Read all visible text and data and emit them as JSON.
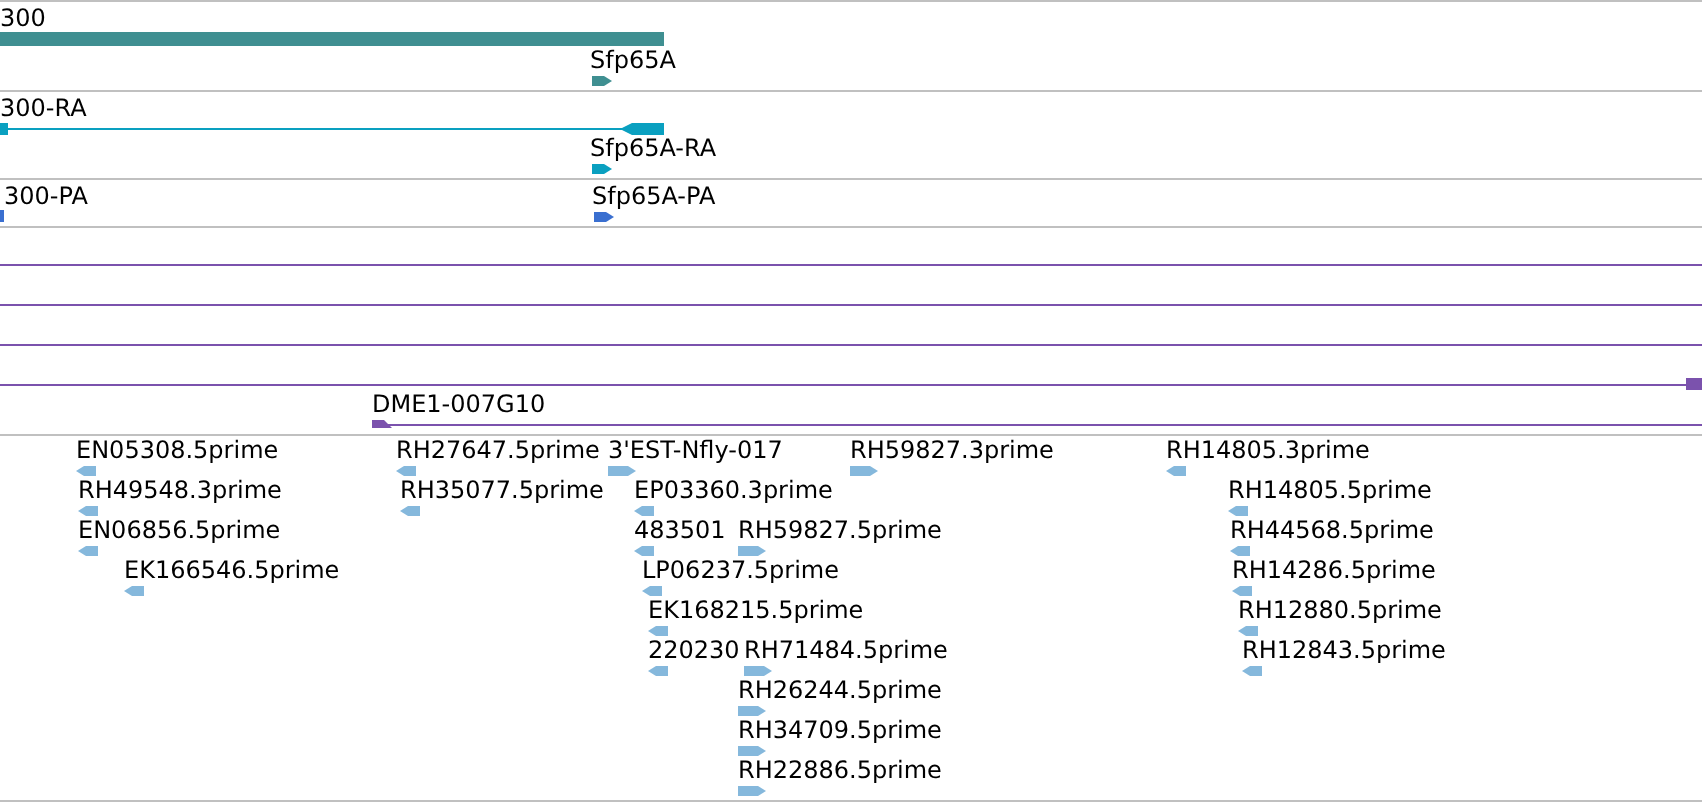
{
  "tracks": [
    {
      "kind": "gene",
      "features": [
        {
          "label": "300"
        },
        {
          "label": "Sfp65A",
          "reverse": false
        }
      ]
    },
    {
      "kind": "transcript",
      "features": [
        {
          "label": "300-RA",
          "reverse": true
        },
        {
          "label": "Sfp65A-RA",
          "reverse": false
        }
      ]
    },
    {
      "kind": "protein",
      "features": [
        {
          "label": "300-PA"
        },
        {
          "label": "Sfp65A-PA",
          "reverse": false
        }
      ]
    },
    {
      "kind": "clone",
      "features": [
        {
          "label": "DME1-007G10",
          "reverse": true
        }
      ]
    },
    {
      "kind": "est",
      "features": [
        {
          "label": "EN05308.5prime",
          "reverse": true
        },
        {
          "label": "RH49548.3prime",
          "reverse": true
        },
        {
          "label": "EN06856.5prime",
          "reverse": true
        },
        {
          "label": "EK166546.5prime",
          "reverse": true
        },
        {
          "label": "RH27647.5prime",
          "reverse": true
        },
        {
          "label": "RH35077.5prime",
          "reverse": true
        },
        {
          "label": "3'EST-Nfly-017",
          "reverse": false
        },
        {
          "label": "EP03360.3prime",
          "reverse": true
        },
        {
          "label": "483501",
          "reverse": true
        },
        {
          "label": "RH59827.5prime",
          "reverse": false
        },
        {
          "label": "LP06237.5prime",
          "reverse": true
        },
        {
          "label": "EK168215.5prime",
          "reverse": true
        },
        {
          "label": "220230",
          "reverse": true
        },
        {
          "label": "RH71484.5prime",
          "reverse": false
        },
        {
          "label": "RH26244.5prime",
          "reverse": false
        },
        {
          "label": "RH34709.5prime",
          "reverse": false
        },
        {
          "label": "RH22886.5prime",
          "reverse": false
        },
        {
          "label": "RH59827.3prime",
          "reverse": false
        },
        {
          "label": "RH14805.3prime",
          "reverse": true
        },
        {
          "label": "RH14805.5prime",
          "reverse": true
        },
        {
          "label": "RH44568.5prime",
          "reverse": true
        },
        {
          "label": "RH14286.5prime",
          "reverse": true
        },
        {
          "label": "RH12880.5prime",
          "reverse": true
        },
        {
          "label": "RH12843.5prime",
          "reverse": true
        }
      ]
    }
  ]
}
